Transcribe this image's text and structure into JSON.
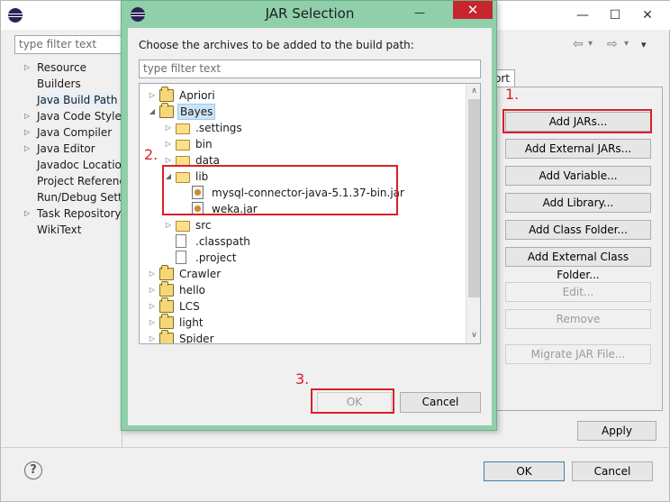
{
  "bg_window": {
    "filter_placeholder": "type filter text",
    "min_glyph": "—",
    "max_glyph": "☐",
    "close_glyph": "✕",
    "nav_glyphs": [
      "⇦",
      "▾",
      "⇨",
      "▾",
      "▾"
    ],
    "left_tree": [
      {
        "label": "Resource",
        "expandable": true
      },
      {
        "label": "Builders",
        "expandable": false
      },
      {
        "label": "Java Build Path",
        "expandable": false,
        "selected": true
      },
      {
        "label": "Java Code Style",
        "expandable": true
      },
      {
        "label": "Java Compiler",
        "expandable": true
      },
      {
        "label": "Java Editor",
        "expandable": true
      },
      {
        "label": "Javadoc Locatio",
        "expandable": false
      },
      {
        "label": "Project Referenc",
        "expandable": false
      },
      {
        "label": "Run/Debug Setti",
        "expandable": false
      },
      {
        "label": "Task Repository",
        "expandable": true
      },
      {
        "label": "WikiText",
        "expandable": false
      }
    ],
    "tab_partial_label": "ort",
    "buttons": {
      "add_jars": "Add JARs...",
      "add_external_jars": "Add External JARs...",
      "add_variable": "Add Variable...",
      "add_library": "Add Library...",
      "add_class_folder": "Add Class Folder...",
      "add_external_class_folder": "Add External Class Folder...",
      "edit": "Edit...",
      "remove": "Remove",
      "migrate_jar": "Migrate JAR File...",
      "apply": "Apply",
      "ok": "OK",
      "cancel": "Cancel"
    },
    "help_glyph": "?"
  },
  "annotations": {
    "step1": "1.",
    "step2": "2.",
    "step3": "3.",
    "color": "#d9202a"
  },
  "dialog": {
    "title": "JAR Selection",
    "min_glyph": "—",
    "close_glyph": "✕",
    "message": "Choose the archives to be added to the build path:",
    "filter_placeholder": "type filter text",
    "tree": [
      {
        "label": "Apriori",
        "icon": "project",
        "exp": "▷"
      },
      {
        "label": "Bayes",
        "icon": "project",
        "exp": "◢",
        "selected": true
      },
      {
        "label": ".settings",
        "icon": "folder",
        "exp": "▷"
      },
      {
        "label": "bin",
        "icon": "folder",
        "exp": "▷"
      },
      {
        "label": "data",
        "icon": "folder",
        "exp": "▷"
      },
      {
        "label": "lib",
        "icon": "folder",
        "exp": "◢"
      },
      {
        "label": "mysql-connector-java-5.1.37-bin.jar",
        "icon": "jar",
        "exp": ""
      },
      {
        "label": "weka.jar",
        "icon": "jar",
        "exp": ""
      },
      {
        "label": "src",
        "icon": "folder",
        "exp": "▷"
      },
      {
        "label": ".classpath",
        "icon": "file",
        "exp": ""
      },
      {
        "label": ".project",
        "icon": "file",
        "exp": ""
      },
      {
        "label": "Crawler",
        "icon": "project",
        "exp": "▷"
      },
      {
        "label": "hello",
        "icon": "project",
        "exp": "▷"
      },
      {
        "label": "LCS",
        "icon": "project",
        "exp": "▷"
      },
      {
        "label": "light",
        "icon": "project",
        "exp": "▷"
      },
      {
        "label": "Spider",
        "icon": "project",
        "exp": "▷"
      }
    ],
    "ok_label": "OK",
    "cancel_label": "Cancel",
    "scroll_up_glyph": "∧",
    "scroll_down_glyph": "∨"
  }
}
